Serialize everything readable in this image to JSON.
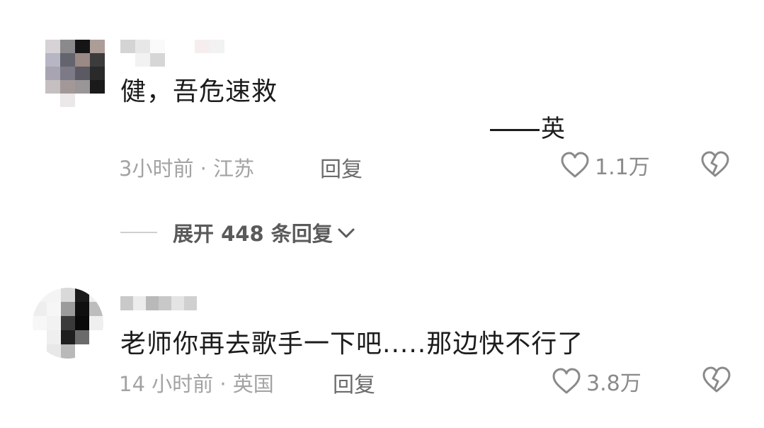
{
  "comments": [
    {
      "text": "健，吾危速救",
      "signature": "英",
      "time": "3小时前",
      "location": "江苏",
      "reply_label": "回复",
      "likes": "1.1万",
      "replies_toggle": "展开 448 条回复"
    },
    {
      "text": "老师你再去歌手一下吧.....那边快不行了",
      "time": "14 小时前",
      "location": "英国",
      "reply_label": "回复",
      "likes": "3.8万"
    }
  ],
  "meta_separator": "·",
  "icons": {
    "like": "heart-outline-icon",
    "dislike": "broken-heart-icon",
    "expand": "chevron-down-icon"
  },
  "colors": {
    "text": "#1c1c1c",
    "meta": "#a3a3a3",
    "reply": "#6b6b6b",
    "icon": "#8a8a8a"
  }
}
